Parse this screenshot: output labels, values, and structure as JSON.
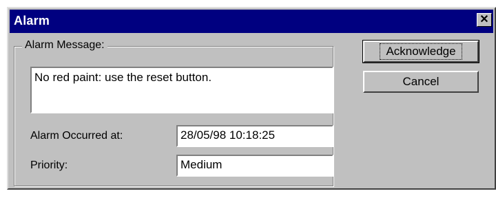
{
  "window": {
    "title": "Alarm",
    "close_glyph": "✕"
  },
  "group": {
    "label": "Alarm Message:"
  },
  "message": {
    "value": "No red paint: use the reset button."
  },
  "occurred": {
    "label": "Alarm Occurred at:",
    "value": "28/05/98  10:18:25"
  },
  "priority": {
    "label": "Priority:",
    "value": "Medium"
  },
  "buttons": {
    "acknowledge": "Acknowledge",
    "cancel": "Cancel"
  },
  "colors": {
    "title_bar": "#000080",
    "face": "#c0c0c0",
    "field": "#ffffff"
  }
}
